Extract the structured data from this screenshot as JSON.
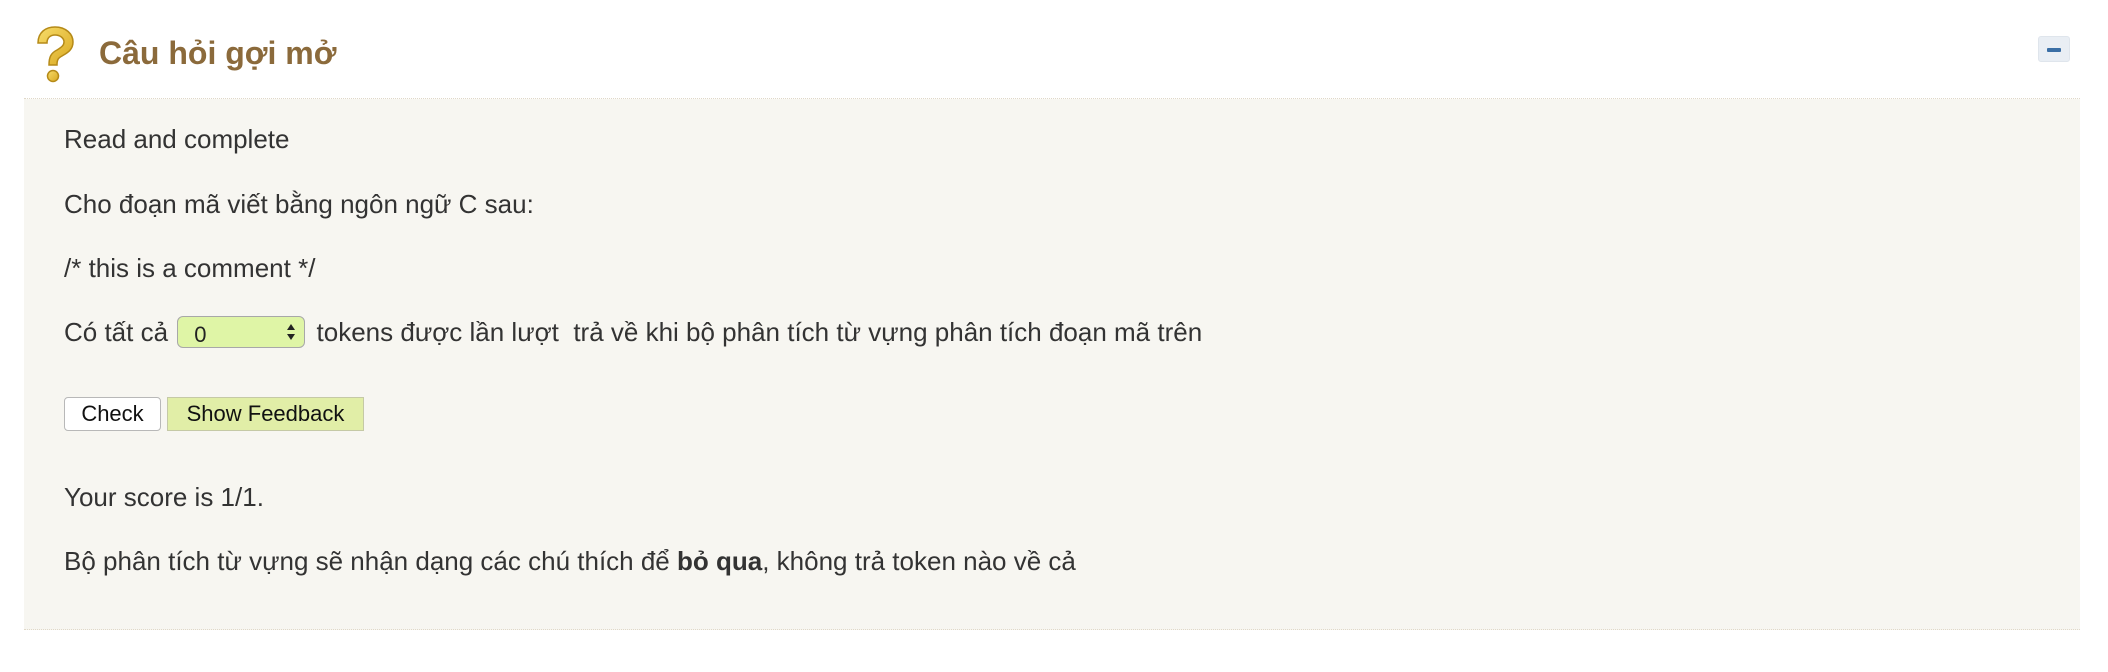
{
  "header": {
    "title": "Câu hỏi gợi mở",
    "icon": "question-mark-icon",
    "collapse_icon": "minus-icon"
  },
  "content": {
    "instruction": "Read and complete",
    "question_intro": "Cho đoạn mã viết bằng ngôn ngữ C sau:",
    "code_snippet": "/* this is a comment */",
    "sentence_before": "Có tất cả",
    "dropdown_value": "0",
    "sentence_after": "tokens được lần lượt  trả về khi bộ phân tích từ vựng phân tích đoạn mã trên",
    "check_label": "Check",
    "feedback_label": "Show Feedback",
    "score_text": "Your score is 1/1.",
    "feedback_before": "Bộ phân tích từ vựng sẽ nhận dạng các chú thích để ",
    "feedback_bold": "bỏ qua",
    "feedback_after": ", không trả token nào về cả"
  },
  "colors": {
    "title": "#8b6a3b",
    "panel_bg": "#f7f6f1",
    "select_bg": "#dff5a6",
    "feedback_button_bg": "#e1eea7",
    "collapse_accent": "#3a6ea5"
  }
}
